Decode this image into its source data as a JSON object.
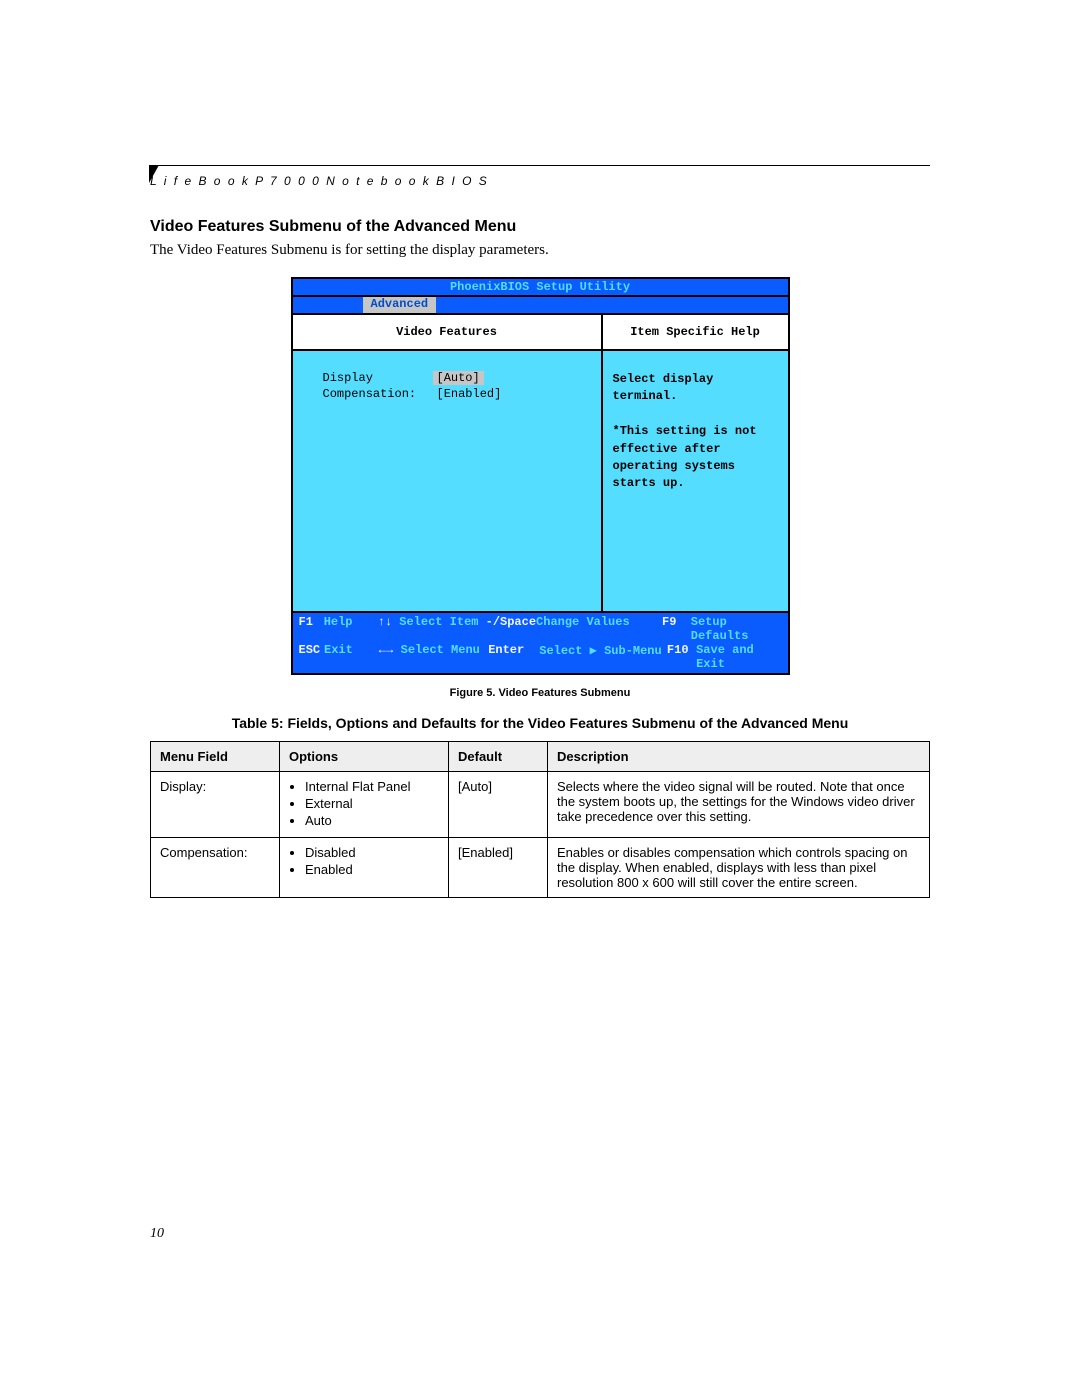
{
  "header": {
    "book_title": "L i f e B o o k   P 7 0 0 0   N o t e b o o k   B I O S"
  },
  "section": {
    "heading": "Video Features Submenu of the Advanced Menu",
    "intro": "The Video Features Submenu is for setting the display parameters."
  },
  "bios": {
    "title": "PhoenixBIOS Setup Utility",
    "active_tab": "Advanced",
    "left_header": "Video Features",
    "right_header": "Item Specific Help",
    "settings": {
      "display_label": "Display",
      "display_value": "[Auto]",
      "comp_label": "Compensation:",
      "comp_value": "[Enabled]"
    },
    "help_text_1": "Select display terminal.",
    "help_text_2": "*This setting is not effective after operating systems starts up.",
    "footer": {
      "f1": "F1",
      "help": "Help",
      "arrows_v": "↑↓",
      "select_item": "Select Item",
      "minus_space": "-/Space",
      "change_values": "Change Values",
      "f9": "F9",
      "setup_defaults": "Setup Defaults",
      "esc": "ESC",
      "exit": "Exit",
      "arrows_h": "←→",
      "select_menu": "Select Menu",
      "enter": "Enter",
      "select_sub": "Select ▶ Sub-Menu",
      "f10": "F10",
      "save_exit": "Save and Exit"
    }
  },
  "figure_caption": "Figure 5.  Video Features Submenu",
  "table_title": "Table 5: Fields, Options and Defaults for the Video Features Submenu of the Advanced Menu",
  "table": {
    "headers": {
      "field": "Menu Field",
      "options": "Options",
      "default": "Default",
      "desc": "Description"
    },
    "rows": [
      {
        "field": "Display:",
        "options": [
          "Internal Flat Panel",
          "External",
          "Auto"
        ],
        "default": "[Auto]",
        "desc": "Selects where the video signal will be routed. Note that once the system boots up, the settings for the Windows video driver take precedence over this setting."
      },
      {
        "field": "Compensation:",
        "options": [
          "Disabled",
          "Enabled"
        ],
        "default": "[Enabled]",
        "desc": "Enables or disables compensation which controls spacing on the display. When enabled, displays with less than pixel resolution 800 x 600 will still cover the entire screen."
      }
    ]
  },
  "page_number": "10"
}
